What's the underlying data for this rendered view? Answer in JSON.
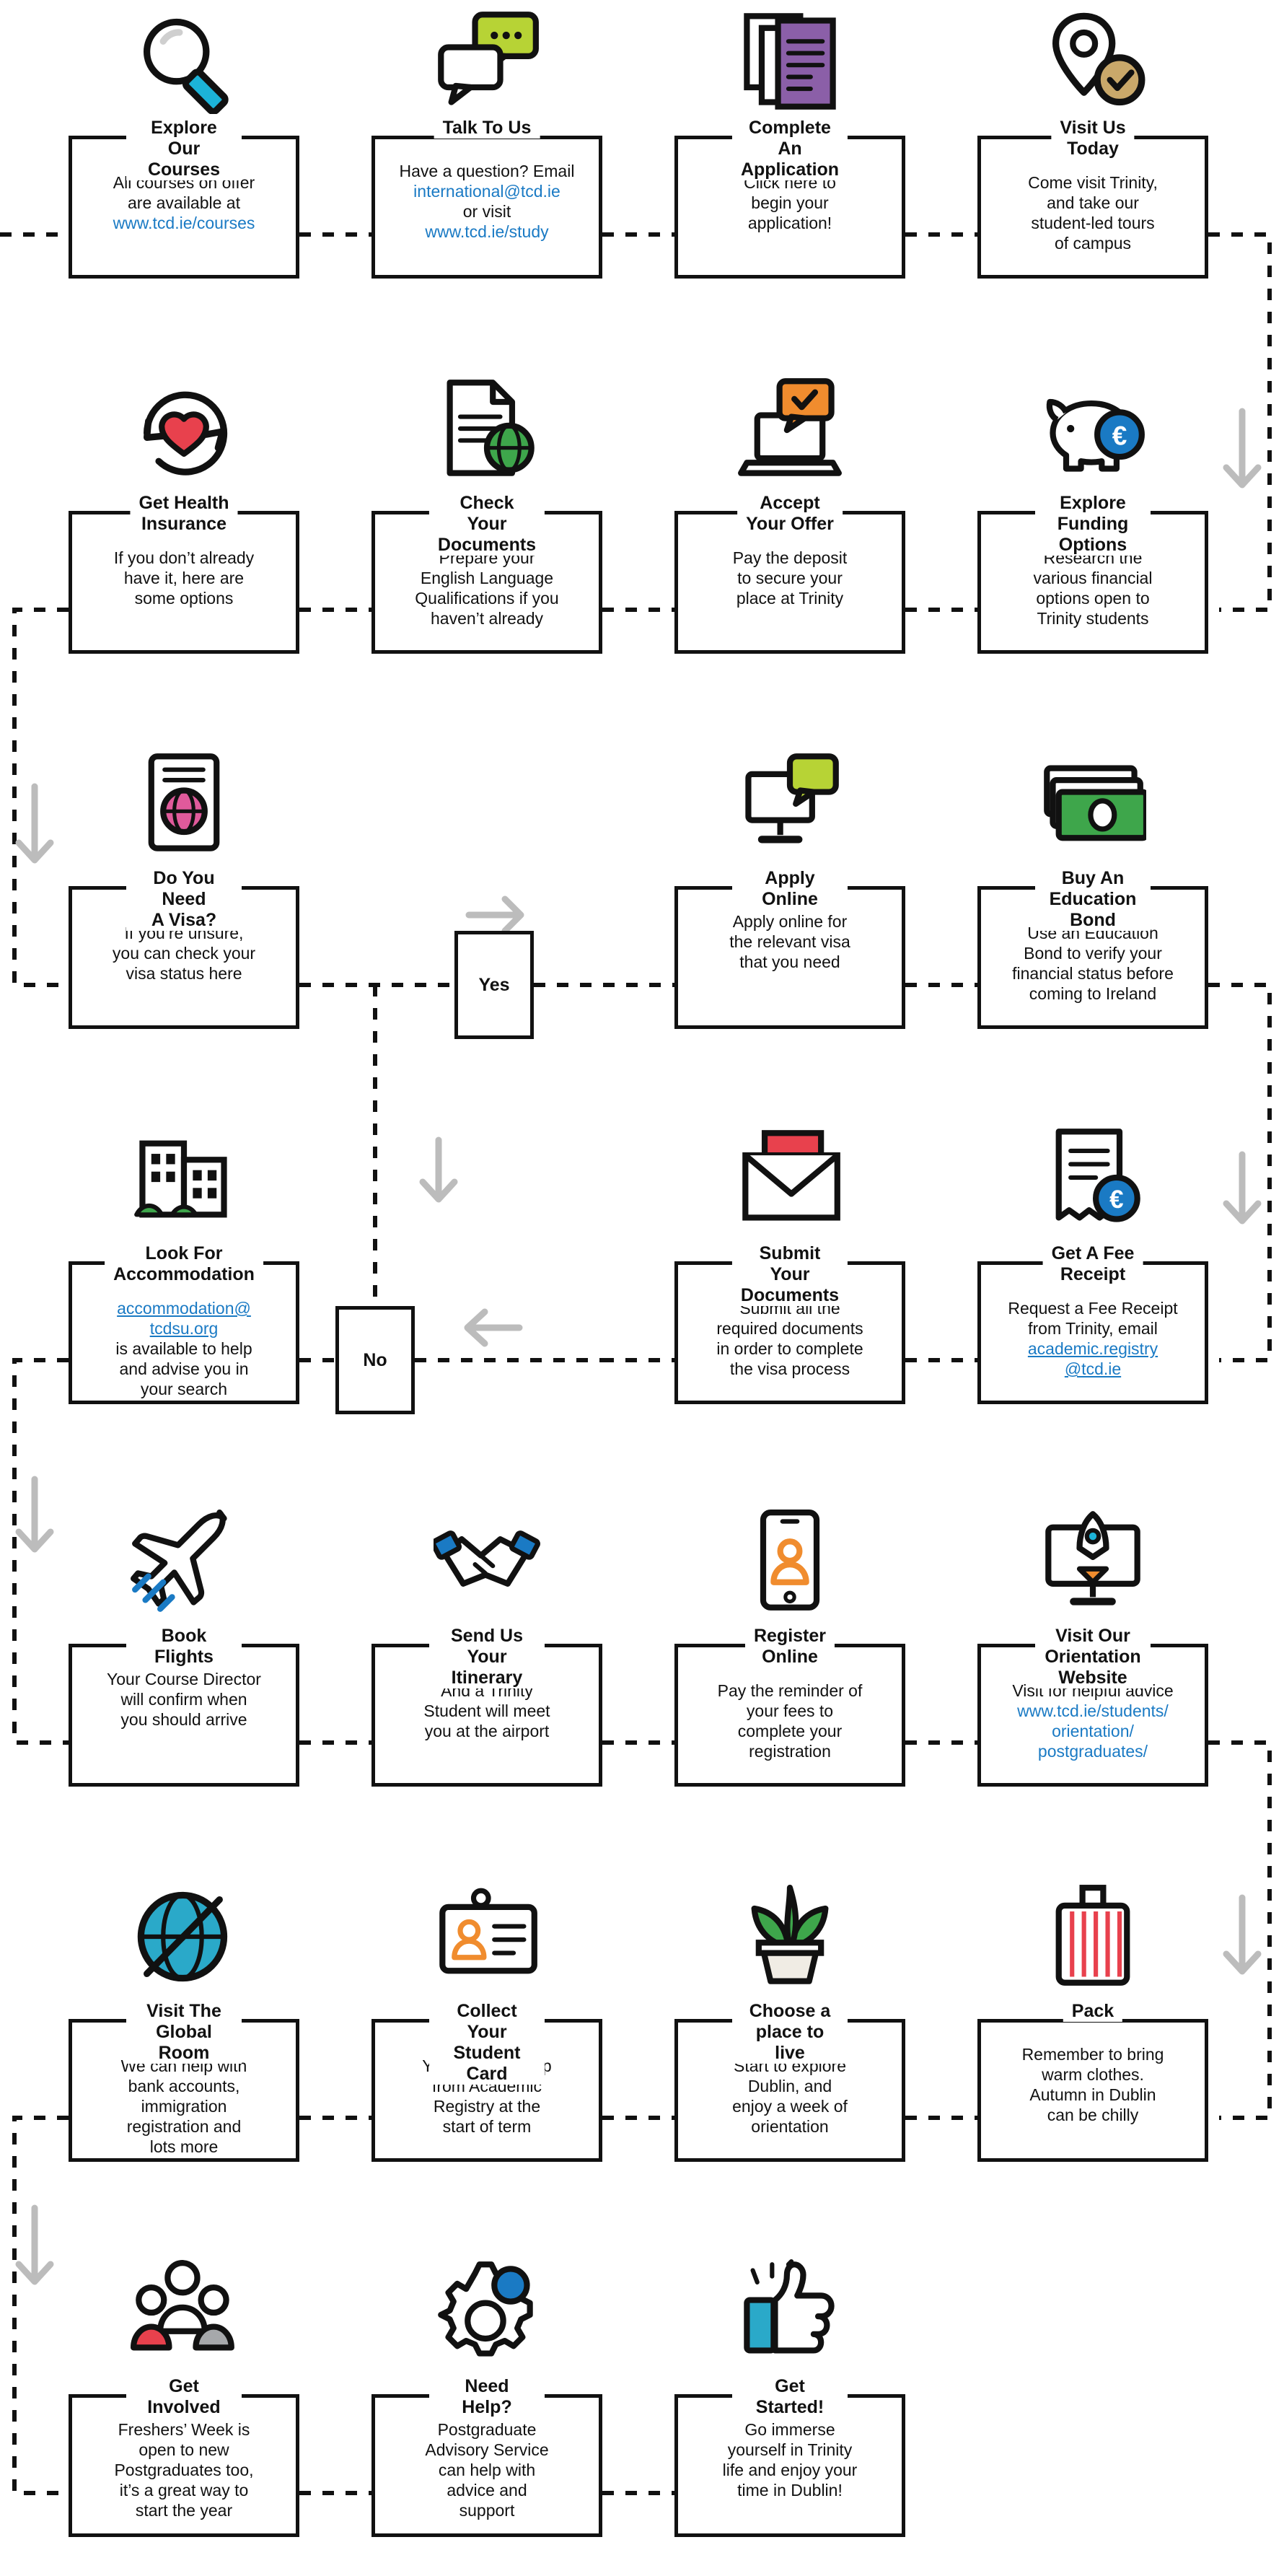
{
  "meta": {
    "link_color": "#1a7ac4",
    "line_color": "#111111",
    "arrow_color": "#bcbcbc",
    "accent_cyan": "#1cb3d8",
    "accent_green": "#b7d335",
    "accent_purple": "#8b5fa8",
    "accent_orange": "#f08c2e",
    "accent_red": "#e8414d",
    "accent_blue": "#1a7ac4",
    "accent_tan": "#c9a86a",
    "accent_grey": "#a6a8ab",
    "accent_teal": "#2aa9c9",
    "accent_leaf": "#3ea64b"
  },
  "decisions": [
    {
      "id": "yes",
      "label": "Yes"
    },
    {
      "id": "no",
      "label": "No"
    }
  ],
  "cards": [
    {
      "id": "explore-our-courses",
      "icon": "magnifier-icon",
      "title": "Explore Our\nCourses",
      "lines": [
        {
          "t": "All courses on offer",
          "k": "p"
        },
        {
          "t": "are available at",
          "k": "p"
        },
        {
          "t": "www.tcd.ie/courses",
          "k": "a"
        }
      ]
    },
    {
      "id": "talk-to-us",
      "icon": "speech-bubbles-icon",
      "title": "Talk To Us",
      "lines": [
        {
          "t": "Have a question? Email",
          "k": "p"
        },
        {
          "t": "international@tcd.ie",
          "k": "a"
        },
        {
          "t": "or visit",
          "k": "p"
        },
        {
          "t": "www.tcd.ie/study",
          "k": "a"
        }
      ]
    },
    {
      "id": "complete-an-application",
      "icon": "documents-icon",
      "title": "Complete An\nApplication",
      "lines": [
        {
          "t": "Click here to",
          "k": "p"
        },
        {
          "t": "begin your",
          "k": "p"
        },
        {
          "t": "application!",
          "k": "p"
        }
      ]
    },
    {
      "id": "visit-us-today",
      "icon": "map-pin-icon",
      "title": "Visit Us\nToday",
      "lines": [
        {
          "t": "Come visit Trinity,",
          "k": "p"
        },
        {
          "t": "and take our",
          "k": "p"
        },
        {
          "t": "student-led tours",
          "k": "p"
        },
        {
          "t": "of campus",
          "k": "p"
        }
      ]
    },
    {
      "id": "get-health-insurance",
      "icon": "heart-shield-icon",
      "title": "Get Health\nInsurance",
      "lines": [
        {
          "t": "If you don’t already",
          "k": "p"
        },
        {
          "t": "have it, here are",
          "k": "p"
        },
        {
          "t": "some options",
          "k": "p"
        }
      ]
    },
    {
      "id": "check-your-documents",
      "icon": "document-globe-icon",
      "title": "Check Your\nDocuments",
      "lines": [
        {
          "t": "Prepare your",
          "k": "p"
        },
        {
          "t": "English Language",
          "k": "p"
        },
        {
          "t": "Qualifications if you",
          "k": "p"
        },
        {
          "t": "haven’t already",
          "k": "p"
        }
      ]
    },
    {
      "id": "accept-your-offer",
      "icon": "laptop-check-icon",
      "title": "Accept\nYour Offer",
      "lines": [
        {
          "t": "Pay the deposit",
          "k": "p"
        },
        {
          "t": "to secure your",
          "k": "p"
        },
        {
          "t": "place at Trinity",
          "k": "p"
        }
      ]
    },
    {
      "id": "explore-funding-options",
      "icon": "piggy-bank-icon",
      "title": "Explore\nFunding Options",
      "lines": [
        {
          "t": "Research the",
          "k": "p"
        },
        {
          "t": "various financial",
          "k": "p"
        },
        {
          "t": "options open to",
          "k": "p"
        },
        {
          "t": "Trinity students",
          "k": "p"
        }
      ]
    },
    {
      "id": "do-you-need-a-visa",
      "icon": "passport-icon",
      "title": "Do You Need\nA Visa?",
      "lines": [
        {
          "t": "If you’re unsure,",
          "k": "p"
        },
        {
          "t": "you can check your",
          "k": "p"
        },
        {
          "t": "visa status here",
          "k": "p"
        }
      ]
    },
    {
      "id": "apply-online",
      "icon": "computer-chat-icon",
      "title": "Apply Online",
      "lines": [
        {
          "t": "Apply online for",
          "k": "p"
        },
        {
          "t": "the relevant visa",
          "k": "p"
        },
        {
          "t": "that you need",
          "k": "p"
        }
      ]
    },
    {
      "id": "buy-an-education-bond",
      "icon": "banknotes-icon",
      "title": "Buy An\nEducation Bond",
      "lines": [
        {
          "t": "Use an Education",
          "k": "p"
        },
        {
          "t": "Bond to verify your",
          "k": "p"
        },
        {
          "t": "financial status before",
          "k": "p"
        },
        {
          "t": "coming to Ireland",
          "k": "p"
        }
      ]
    },
    {
      "id": "look-for-accommodation",
      "icon": "buildings-icon",
      "title": "Look For\nAccommodation",
      "lines": [
        {
          "t": "accommodation@",
          "k": "au"
        },
        {
          "t": "tcdsu.org",
          "k": "au"
        },
        {
          "t": "is available to help",
          "k": "p"
        },
        {
          "t": "and advise you in",
          "k": "p"
        },
        {
          "t": "your search",
          "k": "p"
        }
      ]
    },
    {
      "id": "submit-your-documents",
      "icon": "envelope-icon",
      "title": "Submit Your\nDocuments",
      "lines": [
        {
          "t": "Submit all the",
          "k": "p"
        },
        {
          "t": "required documents",
          "k": "p"
        },
        {
          "t": "in order to complete",
          "k": "p"
        },
        {
          "t": "the visa process",
          "k": "p"
        }
      ]
    },
    {
      "id": "get-a-fee-receipt",
      "icon": "receipt-euro-icon",
      "title": "Get A Fee\nReceipt",
      "lines": [
        {
          "t": "Request a Fee Receipt",
          "k": "p"
        },
        {
          "t": "from Trinity, email",
          "k": "p"
        },
        {
          "t": "academic.registry",
          "k": "au"
        },
        {
          "t": "@tcd.ie",
          "k": "au"
        }
      ]
    },
    {
      "id": "book-flights",
      "icon": "airplane-icon",
      "title": "Book Flights",
      "lines": [
        {
          "t": "Your Course Director",
          "k": "p"
        },
        {
          "t": "will confirm when",
          "k": "p"
        },
        {
          "t": "you should arrive",
          "k": "p"
        }
      ]
    },
    {
      "id": "send-us-your-itinerary",
      "icon": "handshake-icon",
      "title": "Send Us\nYour Itinerary",
      "lines": [
        {
          "t": "And a Trinity",
          "k": "p"
        },
        {
          "t": "Student will meet",
          "k": "p"
        },
        {
          "t": "you at the airport",
          "k": "p"
        }
      ]
    },
    {
      "id": "register-online",
      "icon": "smartphone-user-icon",
      "title": "Register\nOnline",
      "lines": [
        {
          "t": "Pay the reminder of",
          "k": "p"
        },
        {
          "t": "your fees to",
          "k": "p"
        },
        {
          "t": "complete your",
          "k": "p"
        },
        {
          "t": "registration",
          "k": "p"
        }
      ]
    },
    {
      "id": "visit-our-orientation-website",
      "icon": "rocket-monitor-icon",
      "title": "Visit Our\nOrientation Website",
      "lines": [
        {
          "t": "Visit for helpful advice",
          "k": "p"
        },
        {
          "t": "www.tcd.ie/students/",
          "k": "a"
        },
        {
          "t": "orientation/",
          "k": "a"
        },
        {
          "t": "postgraduates/",
          "k": "a"
        }
      ]
    },
    {
      "id": "visit-the-global-room",
      "icon": "globe-icon",
      "title": "Visit The\nGlobal Room",
      "lines": [
        {
          "t": "We can help with",
          "k": "p"
        },
        {
          "t": "bank accounts,",
          "k": "p"
        },
        {
          "t": "immigration",
          "k": "p"
        },
        {
          "t": "registration and",
          "k": "p"
        },
        {
          "t": "lots more",
          "k": "p"
        }
      ]
    },
    {
      "id": "collect-your-student-card",
      "icon": "id-card-icon",
      "title": "Collect Your\nStudent Card",
      "lines": [
        {
          "t": "You can pick it up",
          "k": "p"
        },
        {
          "t": "from Academic",
          "k": "p"
        },
        {
          "t": "Registry at the",
          "k": "p"
        },
        {
          "t": "start of term",
          "k": "p"
        }
      ]
    },
    {
      "id": "choose-a-place-to-live",
      "icon": "potted-plant-icon",
      "title": "Choose a\nplace to live",
      "lines": [
        {
          "t": "Start to explore",
          "k": "p"
        },
        {
          "t": "Dublin, and",
          "k": "p"
        },
        {
          "t": "enjoy a week of",
          "k": "p"
        },
        {
          "t": "orientation",
          "k": "p"
        }
      ]
    },
    {
      "id": "pack",
      "icon": "suitcase-icon",
      "title": "Pack",
      "lines": [
        {
          "t": "Remember to bring",
          "k": "p"
        },
        {
          "t": "warm clothes.",
          "k": "p"
        },
        {
          "t": "Autumn in Dublin",
          "k": "p"
        },
        {
          "t": "can be chilly",
          "k": "p"
        }
      ]
    },
    {
      "id": "get-involved",
      "icon": "people-group-icon",
      "title": "Get Involved",
      "lines": [
        {
          "t": "Freshers’ Week is",
          "k": "p"
        },
        {
          "t": "open to new",
          "k": "p"
        },
        {
          "t": "Postgraduates too,",
          "k": "p"
        },
        {
          "t": "it’s a great way to",
          "k": "p"
        },
        {
          "t": "start the year",
          "k": "p"
        }
      ]
    },
    {
      "id": "need-help",
      "icon": "gears-icon",
      "title": "Need Help?",
      "lines": [
        {
          "t": "Postgraduate",
          "k": "p"
        },
        {
          "t": "Advisory Service",
          "k": "p"
        },
        {
          "t": "can help with",
          "k": "p"
        },
        {
          "t": "advice and",
          "k": "p"
        },
        {
          "t": "support",
          "k": "p"
        }
      ]
    },
    {
      "id": "get-started",
      "icon": "thumbs-up-icon",
      "title": "Get Started!",
      "lines": [
        {
          "t": "Go immerse",
          "k": "p"
        },
        {
          "t": "yourself in Trinity",
          "k": "p"
        },
        {
          "t": "life and enjoy your",
          "k": "p"
        },
        {
          "t": "time in Dublin!",
          "k": "p"
        }
      ]
    }
  ]
}
